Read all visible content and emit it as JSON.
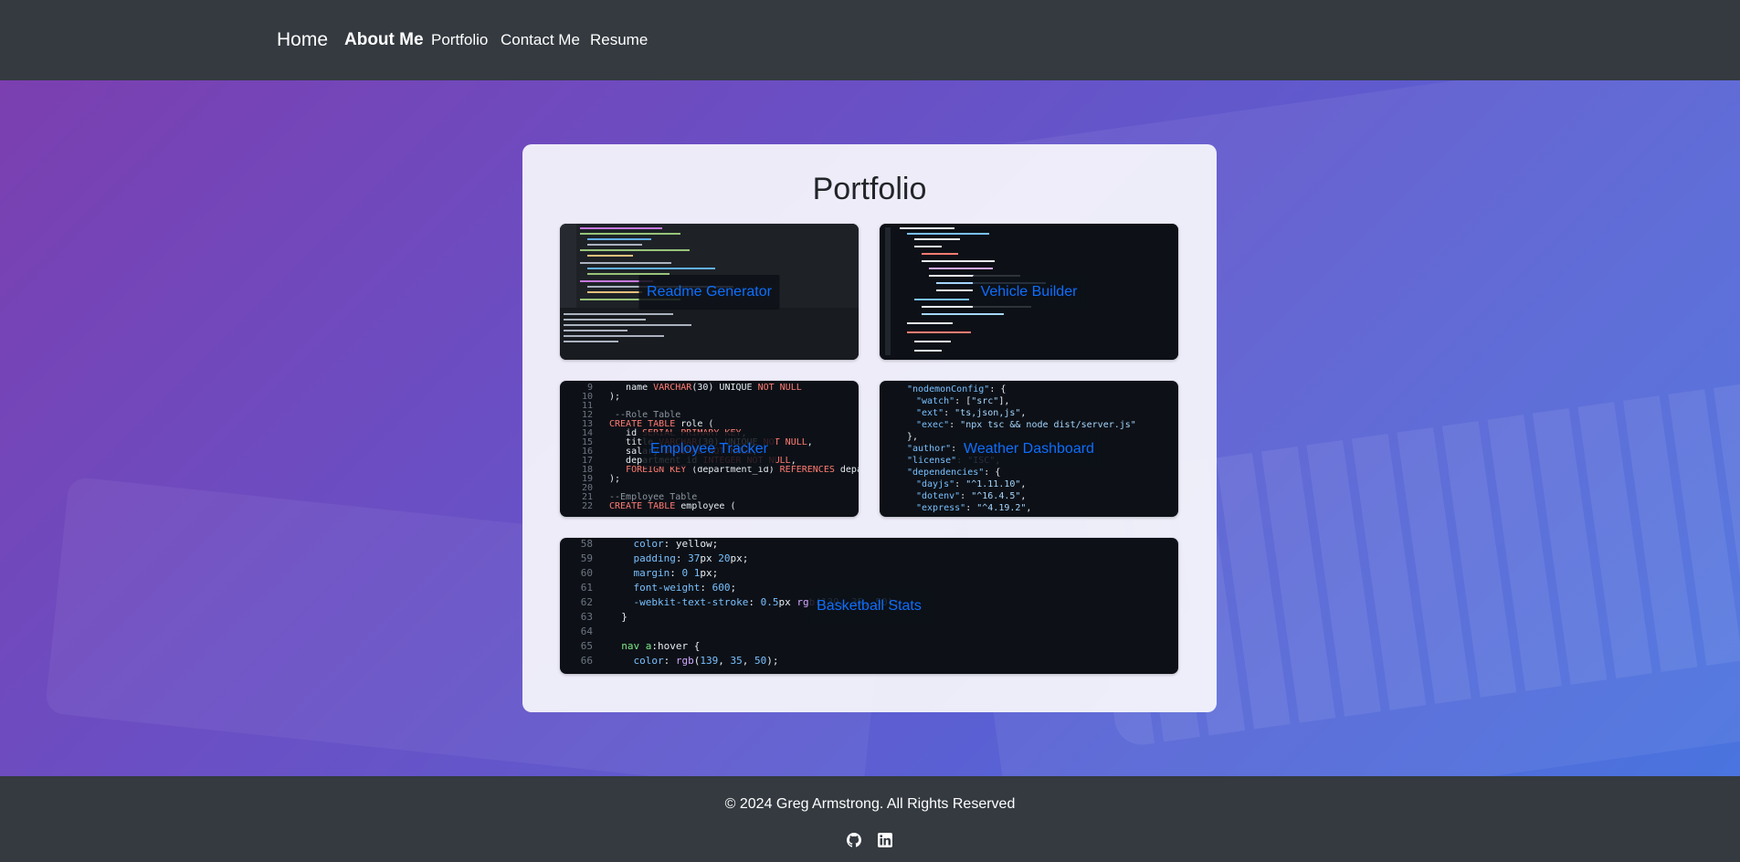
{
  "nav": {
    "brand": "Home",
    "links": [
      {
        "label": "About Me",
        "active": true
      },
      {
        "label": "Portfolio",
        "active": false
      },
      {
        "label": "Contact Me",
        "active": false
      },
      {
        "label": "Resume",
        "active": false
      }
    ]
  },
  "portfolio": {
    "title": "Portfolio",
    "projects": [
      {
        "label": "Readme Generator"
      },
      {
        "label": "Vehicle Builder"
      },
      {
        "label": "Employee Tracker"
      },
      {
        "label": "Weather Dashboard"
      },
      {
        "label": "Basketball Stats"
      }
    ]
  },
  "footer": {
    "copyright": "© 2024 Greg Armstrong. All Rights Reserved",
    "icons": [
      "github-icon",
      "linkedin-icon"
    ]
  },
  "colors": {
    "nav_bg": "#343a40",
    "link_blue": "#0d6efd",
    "hero_start": "#7b3fb0",
    "hero_end": "#4a74df"
  }
}
